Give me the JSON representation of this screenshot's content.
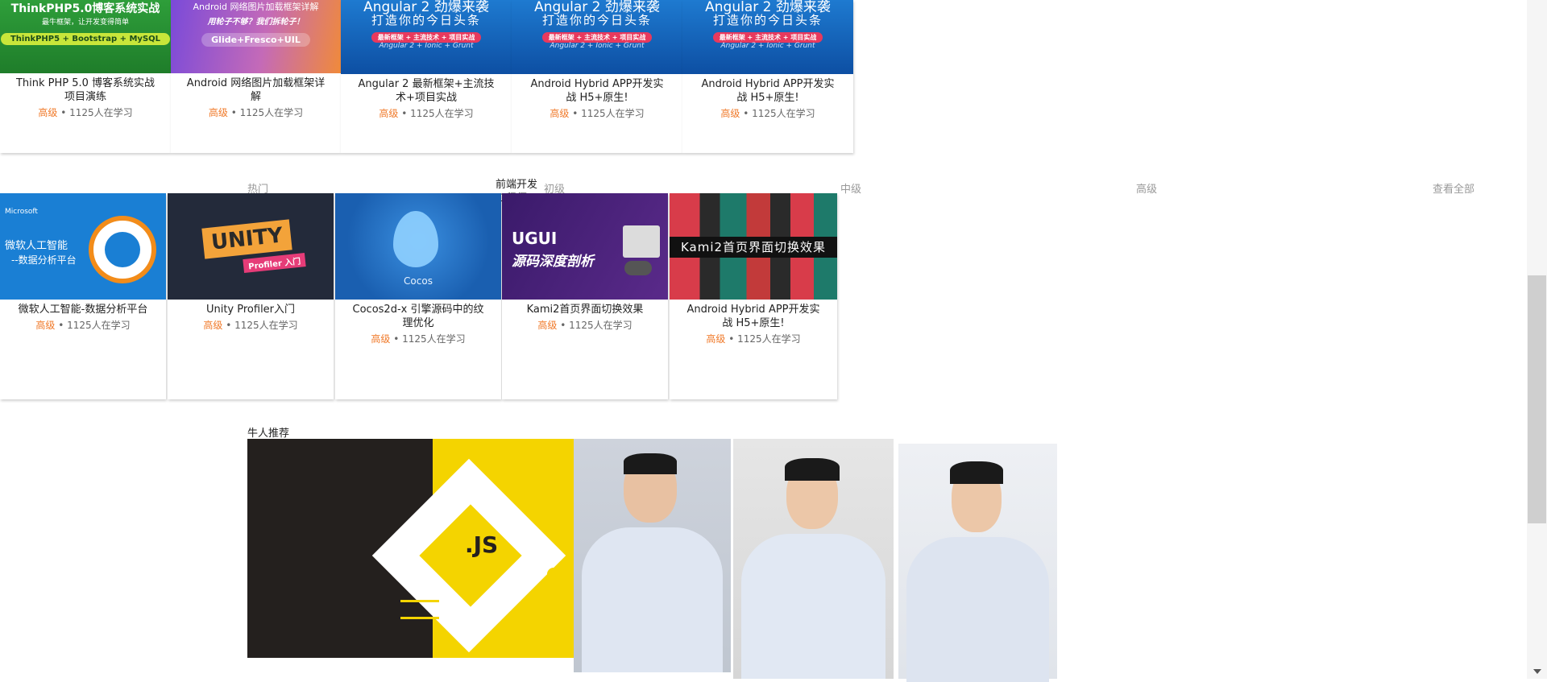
{
  "top_cards": [
    {
      "banner_title": "ThinkPHP5.0博客系统实战",
      "banner_sub": "最牛框架，让开发变得简单",
      "banner_pill": "ThinkPHP5 + Bootstrap + MySQL",
      "title": "Think PHP 5.0 博客系统实战项目演练",
      "level": "高级",
      "students": "1125人在学习"
    },
    {
      "banner_title": "Android 网络图片加载框架详解",
      "banner_sub": "用轮子不够？我们拆轮子！",
      "banner_pill": "Glide+Fresco+UIL",
      "title": "Android 网络图片加载框架详解",
      "level": "高级",
      "students": "1125人在学习"
    },
    {
      "banner_title": "Angular 2 劲爆来袭",
      "banner_sub": "打造你的今日头条",
      "banner_pill": "最新框架 + 主流技术 + 项目实战",
      "banner_foot": "Angular 2 + Ionic + Grunt",
      "title": "Angular 2 最新框架+主流技术+项目实战",
      "level": "高级",
      "students": "1125人在学习"
    },
    {
      "banner_title": "Angular 2 劲爆来袭",
      "banner_sub": "打造你的今日头条",
      "banner_pill": "最新框架 + 主流技术 + 项目实战",
      "banner_foot": "Angular 2 + Ionic + Grunt",
      "title": "Android Hybrid APP开发实战 H5+原生!",
      "level": "高级",
      "students": "1125人在学习"
    },
    {
      "banner_title": "Angular 2 劲爆来袭",
      "banner_sub": "打造你的今日头条",
      "banner_pill": "最新框架 + 主流技术 + 项目实战",
      "banner_foot": "Angular 2 + Ionic + Grunt",
      "title": "Android Hybrid APP开发实战 H5+原生!",
      "level": "高级",
      "students": "1125人在学习"
    }
  ],
  "category": {
    "title": "前端开发工程师",
    "tabs": [
      "热门",
      "初级",
      "中级",
      "高级"
    ],
    "view_all": "查看全部"
  },
  "bottom_cards": [
    {
      "banner_brand": "Microsoft",
      "banner_title": "微软人工智能",
      "banner_sub": "--数据分析平台",
      "title": "微软人工智能-数据分析平台",
      "level": "高级",
      "students": "1125人在学习"
    },
    {
      "banner_title": "UNITY",
      "banner_sub": "Profiler 入门",
      "title": "Unity Profiler入门",
      "level": "高级",
      "students": "1125人在学习"
    },
    {
      "banner_title": "Cocos",
      "title": "Cocos2d-x 引擎源码中的纹理优化",
      "level": "高级",
      "students": "1125人在学习"
    },
    {
      "banner_title": "UGUI",
      "banner_sub": "源码深度剖析",
      "title": "Kami2首页界面切换效果",
      "level": "高级",
      "students": "1125人在学习"
    },
    {
      "banner_title": "Kami2首页界面切换效果",
      "title": "Android Hybrid APP开发实战 H5+原生!",
      "level": "高级",
      "students": "1125人在学习"
    }
  ],
  "experts": {
    "title": "牛人推荐",
    "banner_text": ".JS"
  },
  "colors": {
    "level": "#f07a2a",
    "accent_green": "#2e8b2e",
    "accent_blue": "#1565c0"
  }
}
